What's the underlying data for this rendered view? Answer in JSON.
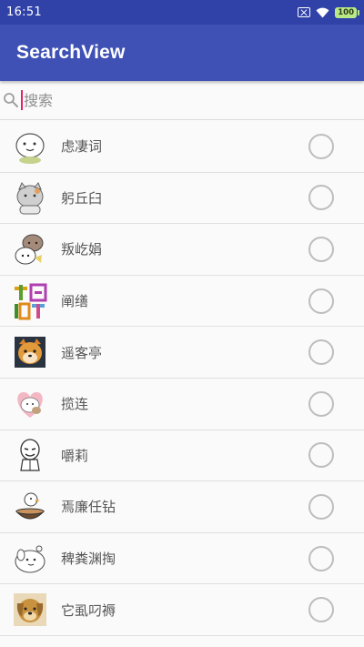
{
  "status": {
    "time": "16:51",
    "battery": "100"
  },
  "app_bar": {
    "title": "SearchView"
  },
  "search": {
    "placeholder": "搜索",
    "value": ""
  },
  "list": [
    {
      "name": "虑凄词",
      "avatar": "white-bear-sticker",
      "checked": false
    },
    {
      "name": "躬丘臼",
      "avatar": "gray-cat-sticker",
      "checked": false
    },
    {
      "name": "叛屹娟",
      "avatar": "cat-pair-sticker",
      "checked": false
    },
    {
      "name": "阐缮",
      "avatar": "birthday-text-sticker",
      "checked": false
    },
    {
      "name": "遥客亭",
      "avatar": "shiba-dog-sticker",
      "checked": false
    },
    {
      "name": "揽连",
      "avatar": "heart-cat-sticker",
      "checked": false
    },
    {
      "name": "嚼莉",
      "avatar": "meme-face-sticker",
      "checked": false
    },
    {
      "name": "焉廉任钻",
      "avatar": "duck-bowl-sticker",
      "checked": false
    },
    {
      "name": "稗粪渊掏",
      "avatar": "white-dog-sticker",
      "checked": false
    },
    {
      "name": "它虱叼褥",
      "avatar": "puppy-photo",
      "checked": false
    }
  ],
  "colors": {
    "status_bar": "#3042a8",
    "app_bar": "#3f51b5",
    "cursor": "#e91e63",
    "radio": "#bdbdbd"
  }
}
